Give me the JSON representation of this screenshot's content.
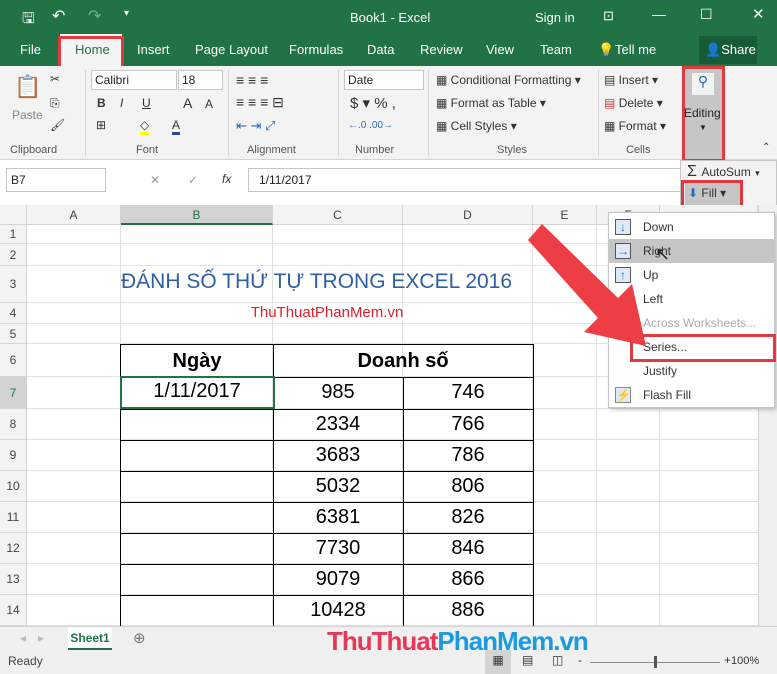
{
  "titlebar": {
    "title": "Book1  -  Excel",
    "signin": "Sign in"
  },
  "tabs": [
    "File",
    "Home",
    "Insert",
    "Page Layout",
    "Formulas",
    "Data",
    "Review",
    "View",
    "Team",
    "Tell me"
  ],
  "share": "Share",
  "ribbon": {
    "paste": "Paste",
    "font_name": "Calibri",
    "font_size": "18",
    "number_format": "Date",
    "conditional_formatting": "Conditional Formatting",
    "format_as_table": "Format as Table",
    "cell_styles": "Cell Styles",
    "insert": "Insert",
    "delete": "Delete",
    "format": "Format",
    "editing": "Editing",
    "groups": [
      "Clipboard",
      "Font",
      "Alignment",
      "Number",
      "Styles",
      "Cells"
    ]
  },
  "editing_panel": {
    "autosum": "AutoSum",
    "fill": "Fill"
  },
  "fill_menu": [
    {
      "label": "Down",
      "icon": "arrow-down"
    },
    {
      "label": "Right",
      "icon": "arrow-right"
    },
    {
      "label": "Up",
      "icon": "arrow-up"
    },
    {
      "label": "Left",
      "icon": ""
    },
    {
      "label": "Across Worksheets...",
      "icon": "",
      "disabled": true
    },
    {
      "label": "Series...",
      "icon": ""
    },
    {
      "label": "Justify",
      "icon": ""
    },
    {
      "label": "Flash Fill",
      "icon": "flash-fill"
    }
  ],
  "formula_bar": {
    "name_box": "B7",
    "fx": "fx",
    "value": "1/11/2017"
  },
  "columns": [
    "A",
    "B",
    "C",
    "D",
    "E",
    "F"
  ],
  "rows": [
    "1",
    "2",
    "3",
    "4",
    "5",
    "6",
    "7",
    "8",
    "9",
    "10",
    "11",
    "12",
    "13",
    "14"
  ],
  "sheet": {
    "title": "ĐÁNH SỐ THỨ TỰ TRONG EXCEL 2016",
    "subtitle": "ThuThuatPhanMem.vn",
    "header_date": "Ngày",
    "header_sales": "Doanh số",
    "b7": "1/11/2017",
    "c": [
      "985",
      "2334",
      "3683",
      "5032",
      "6381",
      "7730",
      "9079",
      "10428"
    ],
    "d": [
      "746",
      "766",
      "786",
      "806",
      "826",
      "846",
      "866",
      "886"
    ]
  },
  "sheet_tab": "Sheet1",
  "status": {
    "ready": "Ready",
    "zoom": "100%"
  },
  "watermark": "ThuThuatPhanMem.vn"
}
